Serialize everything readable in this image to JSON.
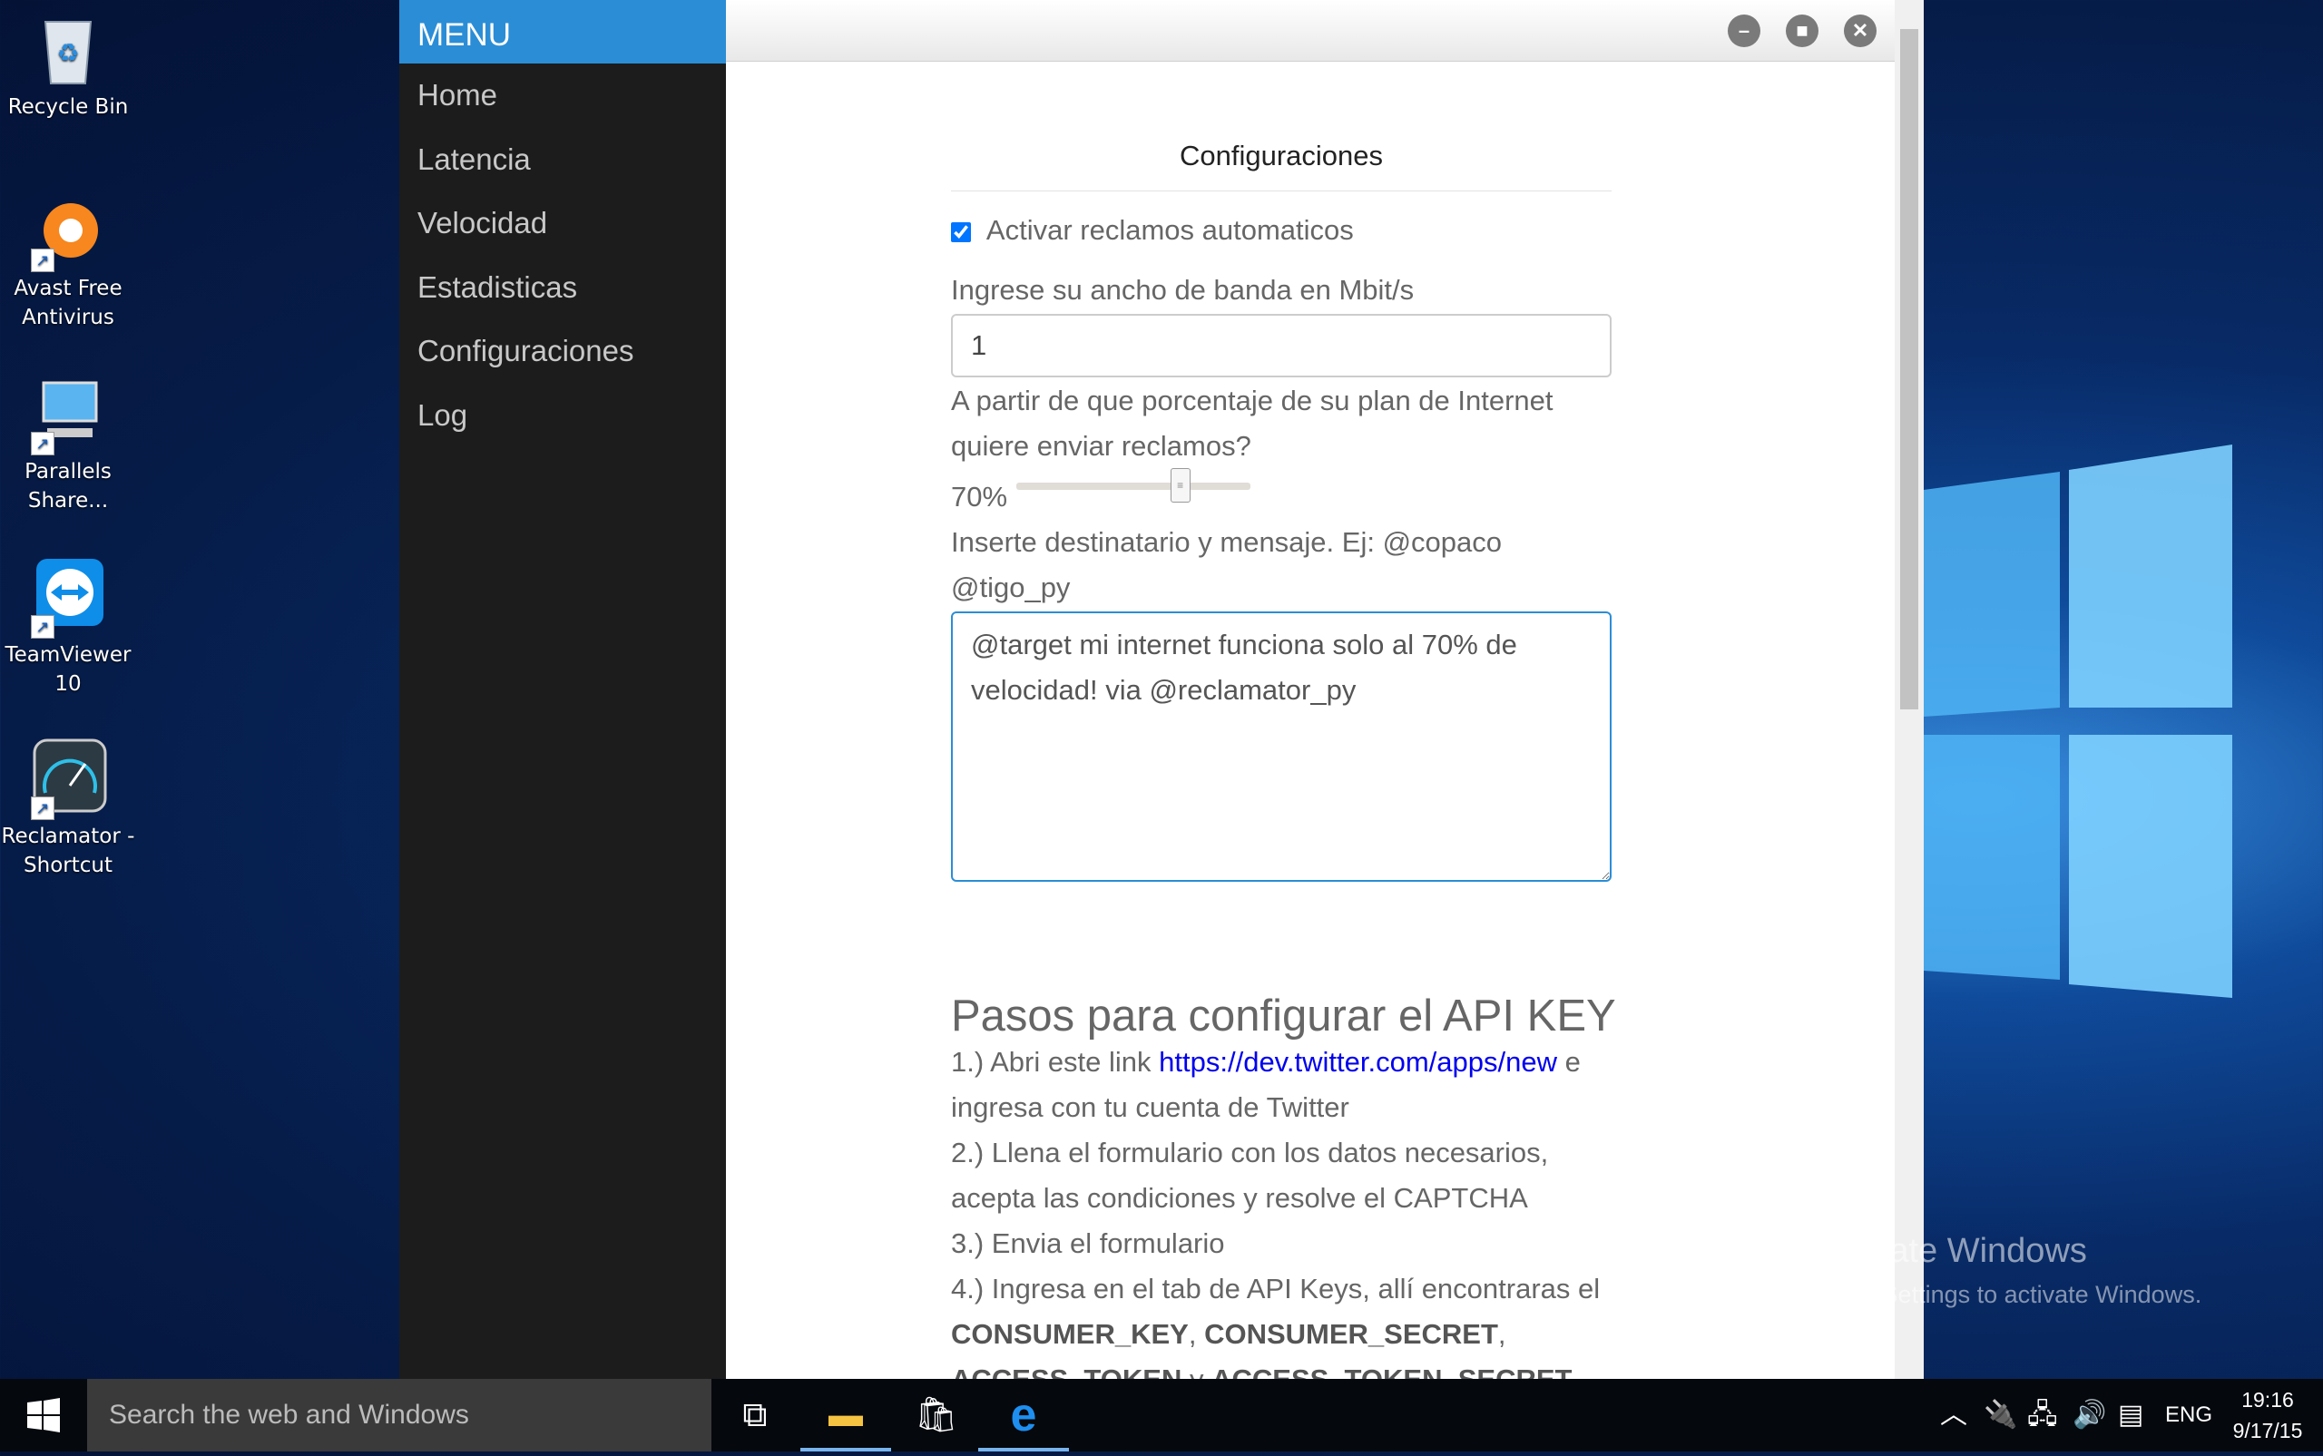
{
  "desktop": {
    "icons": [
      {
        "label": "Recycle Bin"
      },
      {
        "label": "Avast Free Antivirus"
      },
      {
        "label": "Parallels Share..."
      },
      {
        "label": "TeamViewer 10"
      },
      {
        "label": "Reclamator - Shortcut"
      }
    ],
    "watermark": {
      "title": "Activate Windows",
      "subtitle": "Go to Settings to activate Windows."
    }
  },
  "sidebar": {
    "title": "MENU",
    "items": [
      {
        "label": "Home"
      },
      {
        "label": "Latencia"
      },
      {
        "label": "Velocidad"
      },
      {
        "label": "Estadisticas"
      },
      {
        "label": "Configuraciones"
      },
      {
        "label": "Log"
      }
    ]
  },
  "config": {
    "title": "Configuraciones",
    "auto_claims_label": "Activar reclamos automaticos",
    "auto_claims_checked": true,
    "bandwidth_label": "Ingrese su ancho de banda en Mbit/s",
    "bandwidth_value": "1",
    "percent_label_1": "A partir de que porcentaje de su plan de Internet",
    "percent_label_2": "quiere enviar reclamos?",
    "percent_value": "70%",
    "percent_fraction": 0.7,
    "message_label_1": "Inserte destinatario y mensaje. Ej: @copaco",
    "message_label_2": "@tigo_py",
    "message_value": "@target mi internet funciona solo al 70% de velocidad! via @reclamator_py"
  },
  "api": {
    "heading": "Pasos para configurar el API KEY",
    "step1_pre": "1.) Abri este link ",
    "step1_link": "https://dev.twitter.com/apps/new",
    "step1_post": " e ingresa con tu cuenta de Twitter",
    "step2": "2.) Llena el formulario con los datos necesarios, acepta las condiciones y resolve el CAPTCHA",
    "step3": "3.) Envia el formulario",
    "step4_pre": "4.) Ingresa en el tab de API Keys, allí encontraras el ",
    "k1": "CONSUMER_KEY",
    "sep1": ", ",
    "k2": "CONSUMER_SECRET",
    "sep2": ", ",
    "k3": "ACCESS_TOKEN",
    "sep3": " y ",
    "k4": "ACCESS_TOKEN_SECRET"
  },
  "taskbar": {
    "search_placeholder": "Search the web and Windows",
    "lang": "ENG",
    "time": "19:16",
    "date": "9/17/15"
  },
  "colors": {
    "accent": "#2b8dd6",
    "sidebar": "#1c1c1c"
  }
}
